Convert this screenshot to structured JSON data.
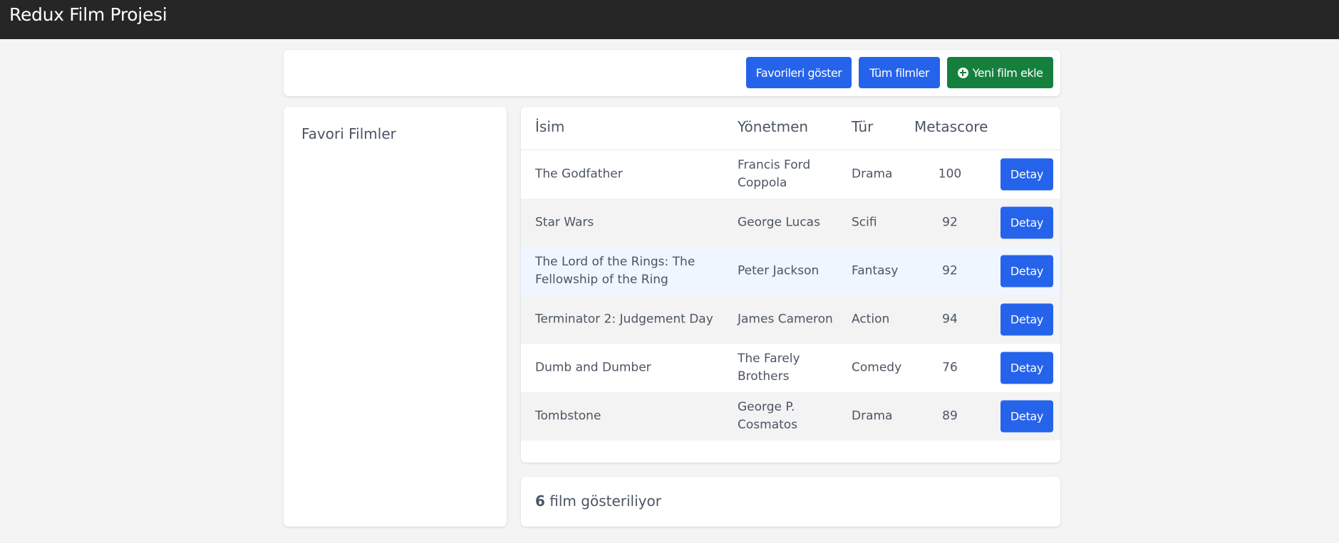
{
  "navbar": {
    "brand": "Redux Film Projesi"
  },
  "toolbar": {
    "favorites_label": "Favorileri göster",
    "all_movies_label": "Tüm filmler",
    "add_movie_label": "Yeni film ekle"
  },
  "sidebar": {
    "title": "Favori Filmler"
  },
  "table": {
    "headers": {
      "name": "İsim",
      "director": "Yönetmen",
      "genre": "Tür",
      "metascore": "Metascore"
    },
    "detail_label": "Detay",
    "rows": [
      {
        "name": "The Godfather",
        "director": "Francis Ford Coppola",
        "genre": "Drama",
        "metascore": "100"
      },
      {
        "name": "Star Wars",
        "director": "George Lucas",
        "genre": "Scifi",
        "metascore": "92"
      },
      {
        "name": "The Lord of the Rings: The Fellowship of the Ring",
        "director": "Peter Jackson",
        "genre": "Fantasy",
        "metascore": "92"
      },
      {
        "name": "Terminator 2: Judgement Day",
        "director": "James Cameron",
        "genre": "Action",
        "metascore": "94"
      },
      {
        "name": "Dumb and Dumber",
        "director": "The Farely Brothers",
        "genre": "Comedy",
        "metascore": "76"
      },
      {
        "name": "Tombstone",
        "director": "George P. Cosmatos",
        "genre": "Drama",
        "metascore": "89"
      }
    ]
  },
  "footer": {
    "count": "6",
    "text": " film gösteriliyor"
  },
  "colors": {
    "primary": "#2563eb",
    "success": "#15803d",
    "navbar": "#262626"
  },
  "icons": {
    "add": "plus-circle-icon"
  }
}
